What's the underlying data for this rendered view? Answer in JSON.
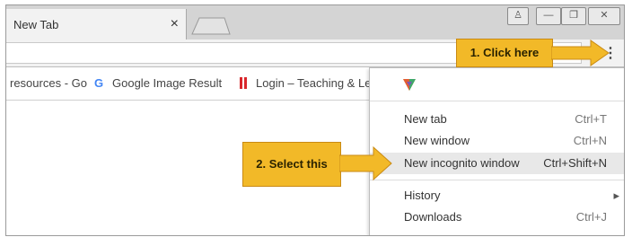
{
  "tab": {
    "title": "New Tab",
    "close_glyph": "×"
  },
  "window_controls": [
    "♙",
    "—",
    "❐",
    "✕"
  ],
  "toolbar": {
    "menu_glyph": "⋮"
  },
  "bookmarks": [
    {
      "label": "resources - Go",
      "icon": "none"
    },
    {
      "label": "Google Image Result",
      "icon": "google-g-icon"
    },
    {
      "label": "Login – Teaching & Le",
      "icon": "red-bars-icon"
    }
  ],
  "menu": {
    "items": [
      {
        "label": "New tab",
        "shortcut": "Ctrl+T"
      },
      {
        "label": "New window",
        "shortcut": "Ctrl+N"
      },
      {
        "label": "New incognito window",
        "shortcut": "Ctrl+Shift+N"
      },
      {
        "label": "History",
        "shortcut": "▸"
      },
      {
        "label": "Downloads",
        "shortcut": "Ctrl+J"
      }
    ]
  },
  "callouts": {
    "step1": "1. Click here",
    "step2": "2. Select this"
  },
  "colors": {
    "callout": "#f2b928",
    "callout_border": "#c98a14",
    "highlight": "#e8e8e8"
  }
}
